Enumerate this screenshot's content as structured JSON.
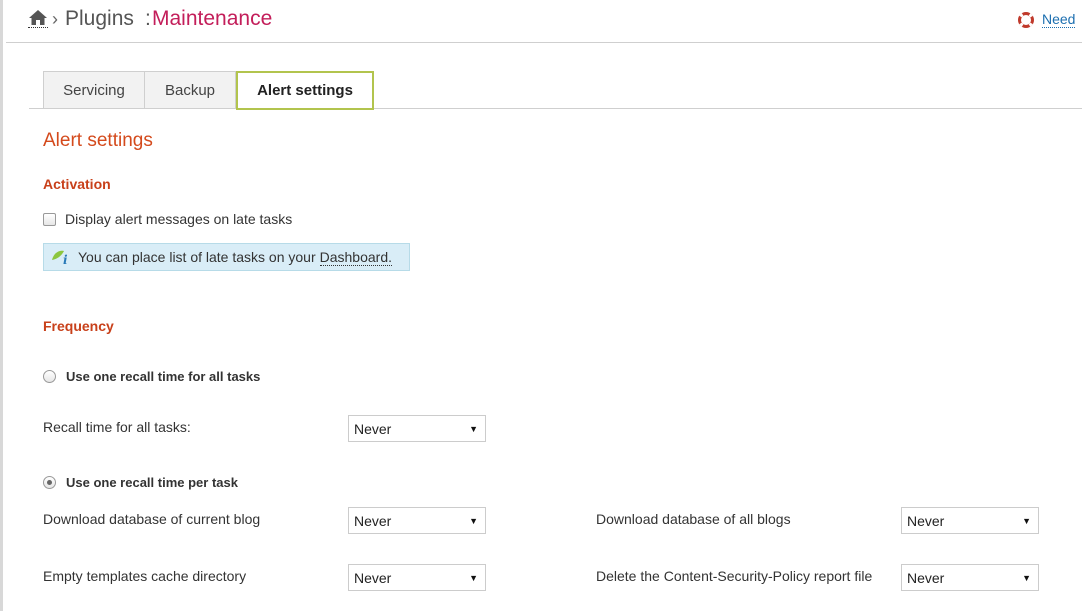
{
  "header": {
    "home_icon": "home-icon",
    "separator": "›",
    "breadcrumb_parent": "Plugins",
    "breadcrumb_colon": ":",
    "breadcrumb_current": "Maintenance",
    "help_icon": "lifebuoy-icon",
    "help_label": "Need"
  },
  "tabs": [
    {
      "label": "Servicing",
      "active": false
    },
    {
      "label": "Backup",
      "active": false
    },
    {
      "label": "Alert settings",
      "active": true
    }
  ],
  "page": {
    "title": "Alert settings",
    "activation": {
      "heading": "Activation",
      "checkbox_label": "Display alert messages on late tasks",
      "checkbox_checked": false,
      "info_text": "You can place list of late tasks on your",
      "info_link": "Dashboard."
    },
    "frequency": {
      "heading": "Frequency",
      "option_one": {
        "label": "Use one recall time for all tasks",
        "selected": false
      },
      "recall_all": {
        "label": "Recall time for all tasks:",
        "value": "Never"
      },
      "option_per_task": {
        "label": "Use one recall time per task",
        "selected": true
      },
      "tasks": [
        {
          "label": "Download database of current blog",
          "value": "Never"
        },
        {
          "label": "Download database of all blogs",
          "value": "Never"
        },
        {
          "label": "Empty templates cache directory",
          "value": "Never"
        },
        {
          "label": "Delete the Content-Security-Policy report file",
          "value": "Never"
        }
      ]
    }
  },
  "colors": {
    "accent_red": "#c31e5a",
    "heading_orange": "#d44a1c",
    "tab_active_border": "#b2c44d",
    "info_bg": "#d9edf7",
    "link_blue": "#1c6fb0"
  }
}
